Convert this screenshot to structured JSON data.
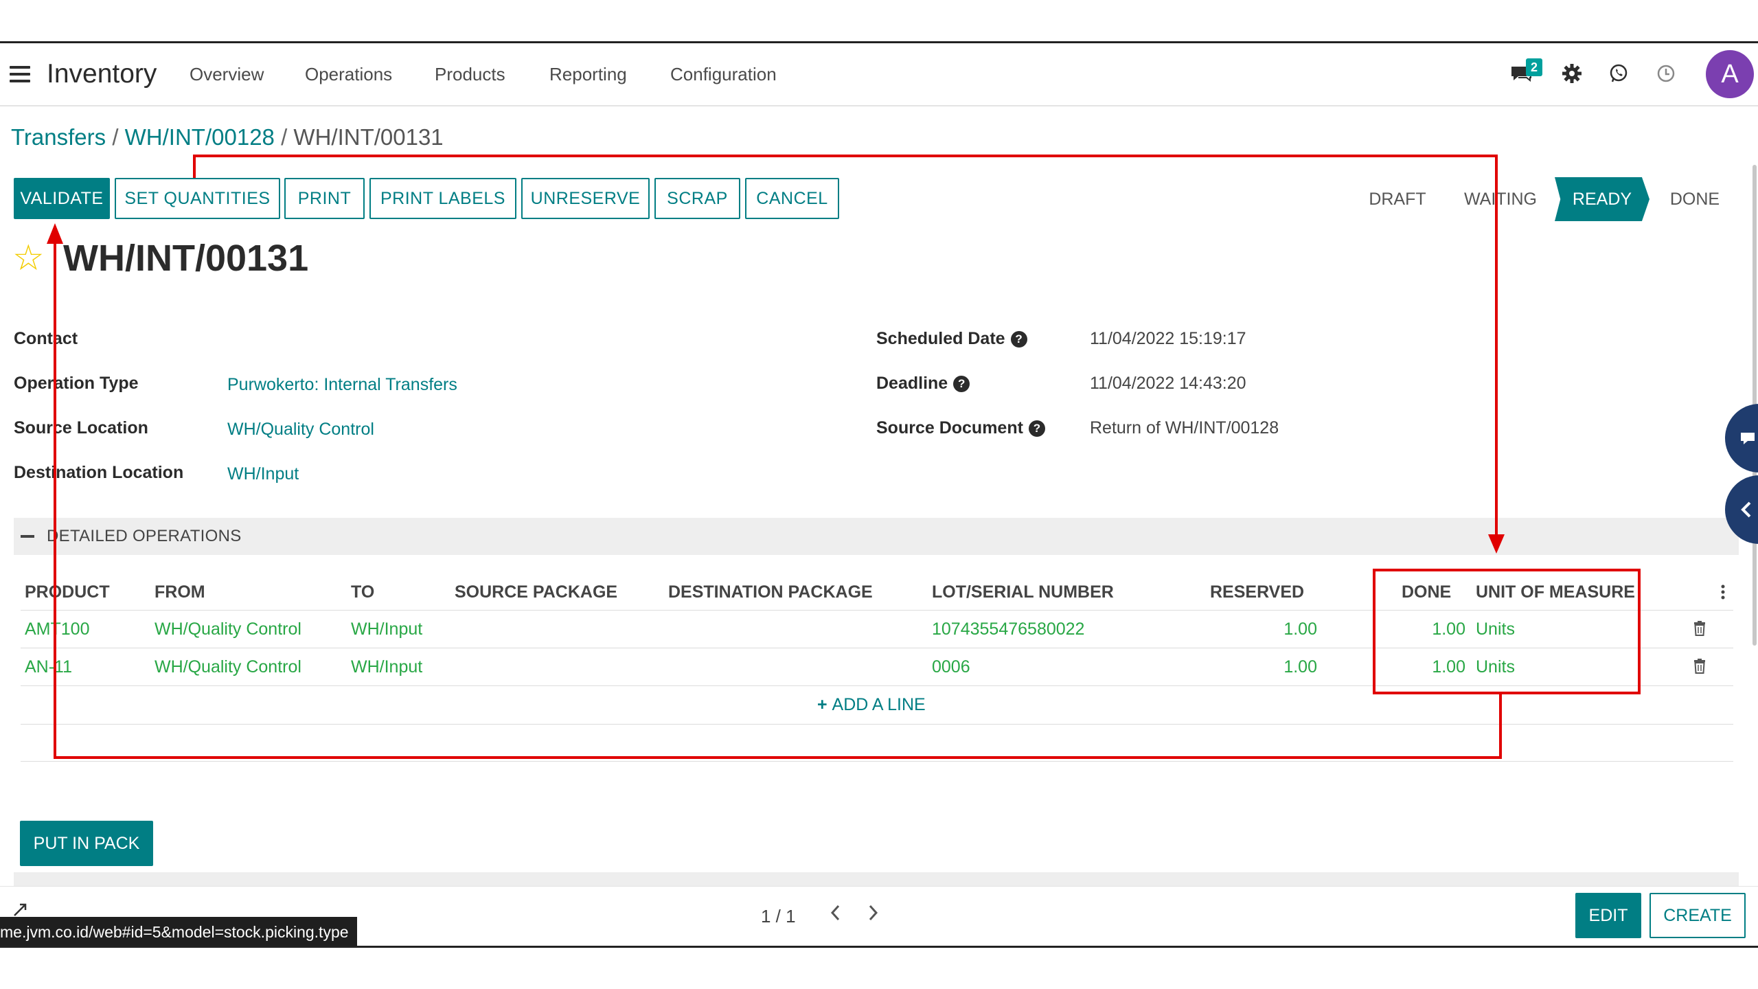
{
  "navbar": {
    "app_title": "Inventory",
    "menu": [
      "Overview",
      "Operations",
      "Products",
      "Reporting",
      "Configuration"
    ],
    "message_badge": "2",
    "avatar_letter": "A",
    "icons": [
      "menu-icon",
      "chat-icon",
      "gear-icon",
      "whatsapp-icon",
      "clock-icon"
    ]
  },
  "breadcrumb": {
    "items": [
      "Transfers",
      "WH/INT/00128",
      "WH/INT/00131"
    ],
    "separator": "/"
  },
  "actions": {
    "validate": "VALIDATE",
    "set_quantities": "SET QUANTITIES",
    "print": "PRINT",
    "print_labels": "PRINT LABELS",
    "unreserve": "UNRESERVE",
    "scrap": "SCRAP",
    "cancel": "CANCEL"
  },
  "status": {
    "stages": [
      "DRAFT",
      "WAITING",
      "READY",
      "DONE"
    ],
    "current": "READY"
  },
  "record": {
    "title": "WH/INT/00131",
    "fields_left": [
      {
        "label": "Contact",
        "value": ""
      },
      {
        "label": "Operation Type",
        "value": "Purwokerto: Internal Transfers"
      },
      {
        "label": "Source Location",
        "value": "WH/Quality Control"
      },
      {
        "label": "Destination Location",
        "value": "WH/Input"
      }
    ],
    "fields_right": [
      {
        "label": "Scheduled Date",
        "value": "11/04/2022 15:19:17"
      },
      {
        "label": "Deadline",
        "value": "11/04/2022 14:43:20"
      },
      {
        "label": "Source Document",
        "value": "Return of WH/INT/00128"
      }
    ]
  },
  "detailed_operations": {
    "title": "DETAILED OPERATIONS",
    "columns": [
      "PRODUCT",
      "FROM",
      "TO",
      "SOURCE PACKAGE",
      "DESTINATION PACKAGE",
      "LOT/SERIAL NUMBER",
      "RESERVED",
      "DONE",
      "UNIT OF MEASURE"
    ],
    "rows": [
      {
        "product": "AMT100",
        "from": "WH/Quality Control",
        "to": "WH/Input",
        "source_package": "",
        "destination_package": "",
        "lot": "1074355476580022",
        "reserved": "1.00",
        "done": "1.00",
        "uom": "Units"
      },
      {
        "product": "AN-11",
        "from": "WH/Quality Control",
        "to": "WH/Input",
        "source_package": "",
        "destination_package": "",
        "lot": "0006",
        "reserved": "1.00",
        "done": "1.00",
        "uom": "Units"
      }
    ],
    "add_line": "ADD A LINE"
  },
  "put_in_pack": "PUT IN PACK",
  "pager": {
    "text": "1 / 1"
  },
  "footer": {
    "edit": "EDIT",
    "create": "CREATE",
    "url_tooltip": "me.jvm.co.id/web#id=5&model=stock.picking.type"
  },
  "colors": {
    "primary": "#017e84",
    "annotation": "#e00000",
    "data_green": "#28a745",
    "star": "#f3cc00"
  }
}
